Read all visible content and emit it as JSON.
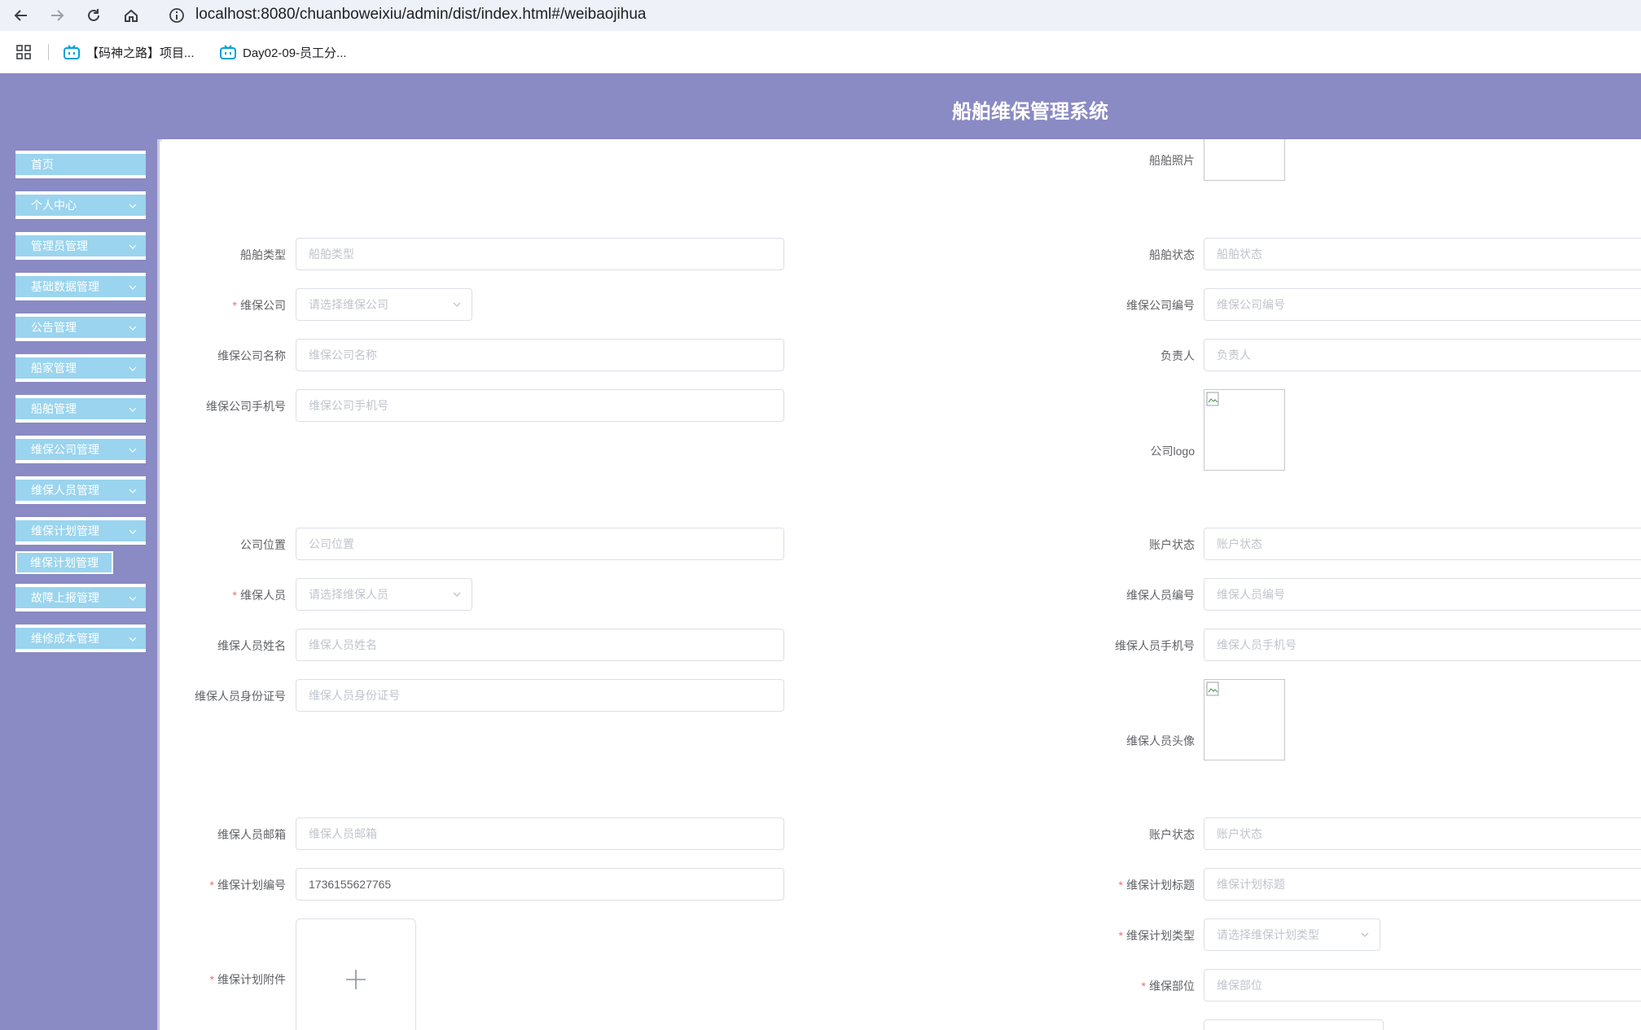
{
  "browser": {
    "url_host": "localhost",
    "url_path": ":8080/chuanboweixiu/admin/dist/index.html#/weibaojihua",
    "bookmarks": [
      {
        "label": "【码神之路】项目..."
      },
      {
        "label": "Day02-09-员工分..."
      }
    ]
  },
  "app": {
    "title": "船舶维保管理系统"
  },
  "sidebar": {
    "items": [
      {
        "label": "首页"
      },
      {
        "label": "个人中心"
      },
      {
        "label": "管理员管理"
      },
      {
        "label": "基础数据管理"
      },
      {
        "label": "公告管理"
      },
      {
        "label": "船家管理"
      },
      {
        "label": "船舶管理"
      },
      {
        "label": "维保公司管理"
      },
      {
        "label": "维保人员管理"
      },
      {
        "label": "维保计划管理"
      },
      {
        "label": "故障上报管理"
      },
      {
        "label": "维修成本管理"
      }
    ],
    "submenu": {
      "label": "维保计划管理"
    }
  },
  "form": {
    "ship_photo": {
      "label": "船舶照片"
    },
    "ship_type": {
      "label": "船舶类型",
      "placeholder": "船舶类型"
    },
    "ship_status": {
      "label": "船舶状态",
      "placeholder": "船舶状态"
    },
    "company": {
      "label": "维保公司",
      "placeholder": "请选择维保公司"
    },
    "company_no": {
      "label": "维保公司编号",
      "placeholder": "维保公司编号"
    },
    "company_name": {
      "label": "维保公司名称",
      "placeholder": "维保公司名称"
    },
    "manager": {
      "label": "负责人",
      "placeholder": "负责人"
    },
    "company_phone": {
      "label": "维保公司手机号",
      "placeholder": "维保公司手机号"
    },
    "company_logo": {
      "label": "公司logo"
    },
    "company_location": {
      "label": "公司位置",
      "placeholder": "公司位置"
    },
    "account_status_1": {
      "label": "账户状态",
      "placeholder": "账户状态"
    },
    "staff": {
      "label": "维保人员",
      "placeholder": "请选择维保人员"
    },
    "staff_no": {
      "label": "维保人员编号",
      "placeholder": "维保人员编号"
    },
    "staff_name": {
      "label": "维保人员姓名",
      "placeholder": "维保人员姓名"
    },
    "staff_phone": {
      "label": "维保人员手机号",
      "placeholder": "维保人员手机号"
    },
    "staff_id": {
      "label": "维保人员身份证号",
      "placeholder": "维保人员身份证号"
    },
    "staff_avatar": {
      "label": "维保人员头像"
    },
    "staff_email": {
      "label": "维保人员邮箱",
      "placeholder": "维保人员邮箱"
    },
    "account_status_2": {
      "label": "账户状态",
      "placeholder": "账户状态"
    },
    "plan_no": {
      "label": "维保计划编号",
      "value": "1736155627765"
    },
    "plan_title": {
      "label": "维保计划标题",
      "placeholder": "维保计划标题"
    },
    "plan_attachment": {
      "label": "维保计划附件"
    },
    "plan_type": {
      "label": "维保计划类型",
      "placeholder": "请选择维保计划类型"
    },
    "plan_part": {
      "label": "维保部位",
      "placeholder": "维保部位"
    }
  },
  "colors": {
    "header": "#8a8ac4",
    "menu": "#9ad4ee",
    "required": "#f56c6c"
  }
}
